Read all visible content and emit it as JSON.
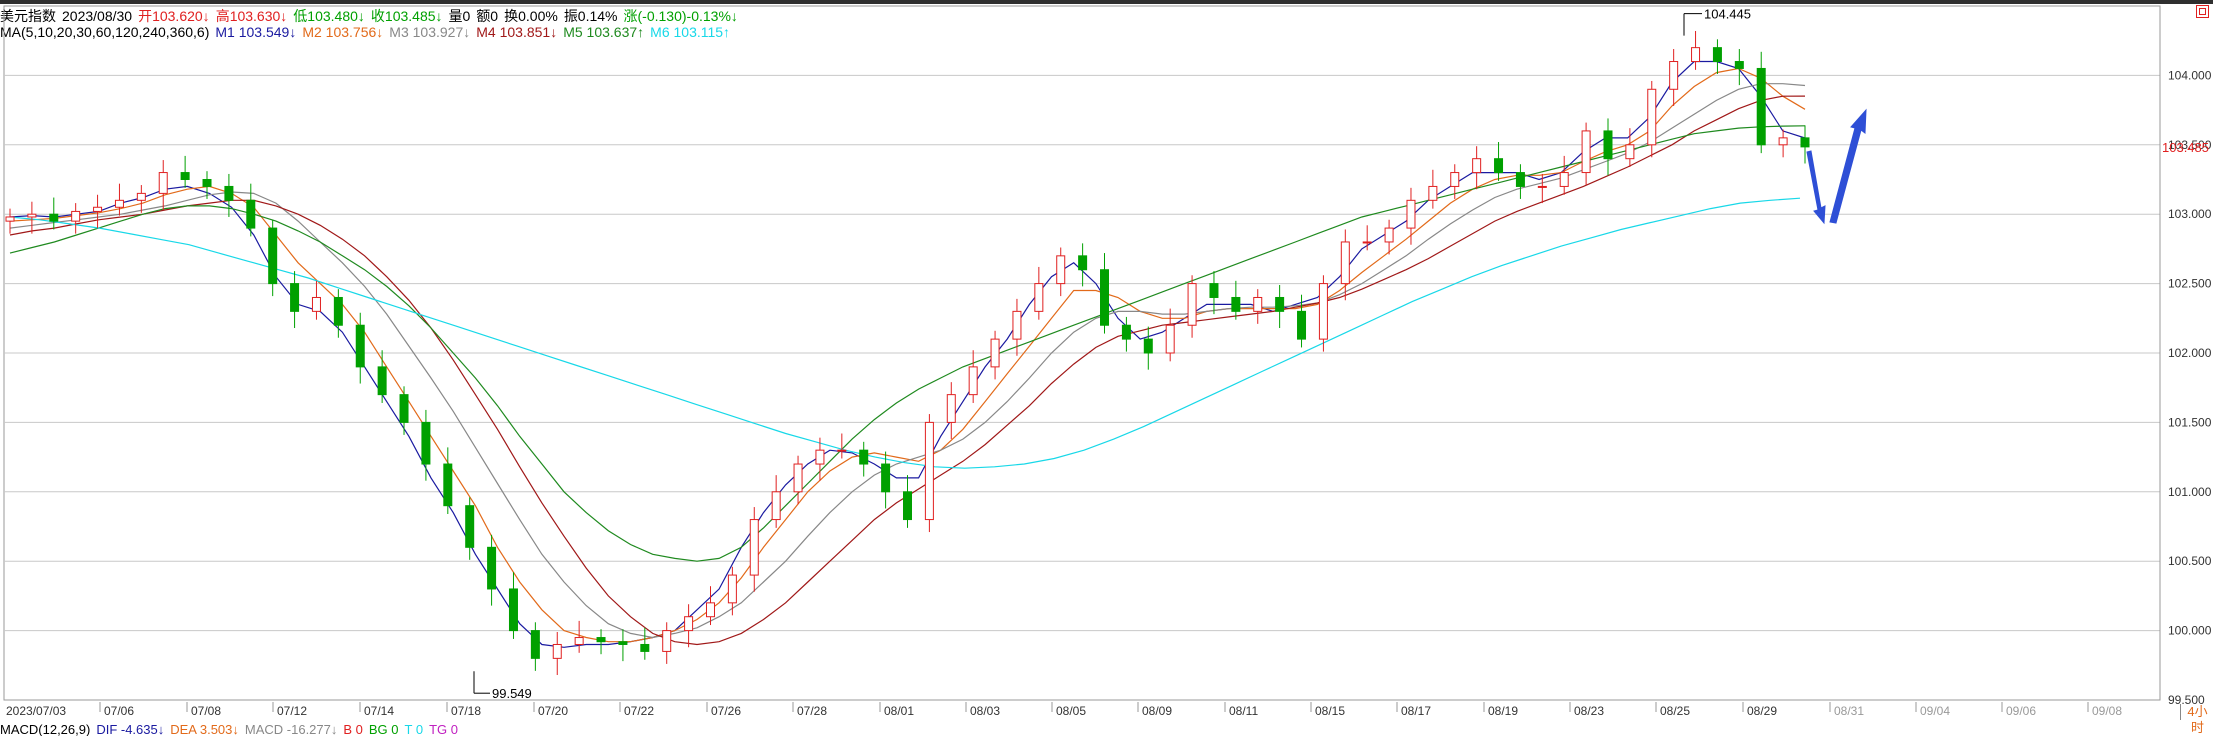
{
  "header": {
    "symbol": "美元指数",
    "date": "2023/08/30",
    "open_label": "开",
    "open": "103.620↓",
    "high_label": "高",
    "high": "103.630↓",
    "low_label": "低",
    "low": "103.480↓",
    "close_label": "收",
    "close": "103.485↓",
    "volume": "量0",
    "amount": "额0",
    "turnover": "换0.00%",
    "amplitude": "振0.14%",
    "change": "涨(-0.130)-0.13%↓"
  },
  "ma_header": {
    "label": "MA(5,10,20,30,60,120,240,360,6)",
    "m1": "M1 103.549↓",
    "m2": "M2 103.756↓",
    "m3": "M3 103.927↓",
    "m4": "M4 103.851↓",
    "m5": "M5 103.637↑",
    "m6": "M6 103.115↑"
  },
  "macd_header": {
    "label": "MACD(12,26,9)",
    "dif": "DIF -4.635↓",
    "dea": "DEA 3.503↓",
    "macd": "MACD -16.277↓",
    "b": "B 0",
    "bg": "BG 0",
    "t": "T 0",
    "tg": "TG 0"
  },
  "period_tab": "4小时",
  "colors": {
    "up": "#e02020",
    "down": "#00a000",
    "ma1": "#1a1aa0",
    "ma2": "#e26a1a",
    "ma3": "#888888",
    "ma4": "#a01818",
    "ma5": "#1f8a1f",
    "ma6": "#18d8e8",
    "arrow": "#2e4fd6",
    "grid": "#c8c8c8"
  },
  "chart_data": {
    "type": "candlestick",
    "ylim": [
      99.5,
      104.5
    ],
    "yticks": [
      "104.000",
      "103.500",
      "103.000",
      "102.500",
      "102.000",
      "101.500",
      "101.000",
      "100.500",
      "100.000",
      "99.500"
    ],
    "current_price": "103.485",
    "xlabels": [
      "2023/07/03",
      "07/06",
      "07/08",
      "07/12",
      "07/14",
      "07/18",
      "07/20",
      "07/22",
      "07/26",
      "07/28",
      "08/01",
      "08/03",
      "08/05",
      "08/09",
      "08/11",
      "08/15",
      "08/17",
      "08/19",
      "08/23",
      "08/25",
      "08/29",
      "08/31",
      "09/04",
      "09/06",
      "09/08"
    ],
    "annotations": [
      {
        "label": "104.445",
        "value": 104.445,
        "type": "high"
      },
      {
        "label": "99.549",
        "value": 99.549,
        "type": "low"
      }
    ],
    "close_series": [
      102.98,
      103.0,
      102.95,
      103.02,
      103.05,
      103.1,
      103.15,
      103.3,
      103.25,
      103.2,
      103.1,
      102.9,
      102.5,
      102.3,
      102.4,
      102.2,
      101.9,
      101.7,
      101.5,
      101.2,
      100.9,
      100.6,
      100.3,
      100.0,
      99.8,
      99.9,
      99.95,
      99.92,
      99.9,
      99.85,
      100.0,
      100.1,
      100.2,
      100.4,
      100.8,
      101.0,
      101.2,
      101.3,
      101.3,
      101.2,
      101.0,
      100.8,
      101.5,
      101.7,
      101.9,
      102.1,
      102.3,
      102.5,
      102.7,
      102.6,
      102.2,
      102.1,
      102.0,
      102.2,
      102.5,
      102.4,
      102.3,
      102.4,
      102.3,
      102.1,
      102.5,
      102.8,
      102.8,
      102.9,
      103.1,
      103.2,
      103.3,
      103.4,
      103.3,
      103.2,
      103.2,
      103.3,
      103.6,
      103.4,
      103.5,
      103.9,
      104.1,
      104.2,
      104.1,
      104.05,
      103.5,
      103.55,
      103.485
    ],
    "ma_series": [
      {
        "name": "M1",
        "values": [
          102.98,
          102.99,
          102.98,
          103.0,
          103.02,
          103.08,
          103.12,
          103.18,
          103.2,
          103.15,
          103.05,
          102.85,
          102.55,
          102.35,
          102.3,
          102.15,
          101.9,
          101.65,
          101.4,
          101.1,
          100.85,
          100.55,
          100.3,
          100.05,
          99.9,
          99.88,
          99.9,
          99.9,
          99.92,
          99.95,
          100.0,
          100.15,
          100.3,
          100.6,
          100.85,
          101.05,
          101.2,
          101.3,
          101.28,
          101.2,
          101.1,
          101.1,
          101.4,
          101.65,
          101.9,
          102.1,
          102.35,
          102.55,
          102.65,
          102.5,
          102.25,
          102.1,
          102.15,
          102.25,
          102.35,
          102.35,
          102.35,
          102.3,
          102.35,
          102.4,
          102.55,
          102.75,
          102.85,
          102.95,
          103.1,
          103.2,
          103.3,
          103.3,
          103.3,
          103.25,
          103.3,
          103.45,
          103.55,
          103.55,
          103.7,
          103.95,
          104.1,
          104.1,
          104.05,
          103.85,
          103.6,
          103.549
        ]
      },
      {
        "name": "M2",
        "values": [
          102.95,
          102.96,
          102.97,
          102.99,
          103.01,
          103.04,
          103.08,
          103.14,
          103.18,
          103.2,
          103.15,
          103.05,
          102.85,
          102.65,
          102.5,
          102.35,
          102.15,
          101.9,
          101.65,
          101.4,
          101.15,
          100.9,
          100.6,
          100.35,
          100.15,
          100.0,
          99.95,
          99.92,
          99.92,
          99.95,
          100.0,
          100.08,
          100.2,
          100.38,
          100.6,
          100.8,
          101.0,
          101.15,
          101.25,
          101.28,
          101.25,
          101.22,
          101.3,
          101.45,
          101.65,
          101.85,
          102.05,
          102.25,
          102.45,
          102.45,
          102.4,
          102.3,
          102.25,
          102.25,
          102.3,
          102.32,
          102.32,
          102.32,
          102.32,
          102.35,
          102.45,
          102.58,
          102.7,
          102.82,
          102.95,
          103.08,
          103.18,
          103.25,
          103.28,
          103.28,
          103.3,
          103.38,
          103.45,
          103.5,
          103.6,
          103.78,
          103.92,
          104.02,
          104.05,
          103.98,
          103.85,
          103.756
        ]
      },
      {
        "name": "M3",
        "values": [
          102.9,
          102.92,
          102.94,
          102.96,
          102.98,
          103.0,
          103.03,
          103.06,
          103.1,
          103.14,
          103.16,
          103.15,
          103.08,
          102.95,
          102.8,
          102.65,
          102.48,
          102.28,
          102.05,
          101.82,
          101.58,
          101.32,
          101.06,
          100.8,
          100.55,
          100.35,
          100.18,
          100.05,
          99.98,
          99.95,
          99.98,
          100.02,
          100.1,
          100.2,
          100.35,
          100.5,
          100.68,
          100.85,
          101.0,
          101.12,
          101.2,
          101.25,
          101.3,
          101.38,
          101.5,
          101.65,
          101.82,
          102.0,
          102.15,
          102.25,
          102.3,
          102.3,
          102.28,
          102.28,
          102.3,
          102.32,
          102.33,
          102.33,
          102.34,
          102.36,
          102.42,
          102.5,
          102.6,
          102.7,
          102.82,
          102.93,
          103.03,
          103.12,
          103.18,
          103.22,
          103.26,
          103.32,
          103.38,
          103.44,
          103.52,
          103.62,
          103.72,
          103.82,
          103.9,
          103.94,
          103.94,
          103.927
        ]
      },
      {
        "name": "M4",
        "values": [
          102.85,
          102.88,
          102.9,
          102.93,
          102.96,
          102.98,
          103.0,
          103.03,
          103.06,
          103.08,
          103.1,
          103.1,
          103.06,
          103.0,
          102.92,
          102.82,
          102.7,
          102.55,
          102.38,
          102.18,
          101.95,
          101.7,
          101.45,
          101.18,
          100.92,
          100.68,
          100.45,
          100.25,
          100.1,
          99.98,
          99.92,
          99.9,
          99.92,
          99.98,
          100.08,
          100.2,
          100.35,
          100.5,
          100.65,
          100.8,
          100.92,
          101.02,
          101.12,
          101.22,
          101.34,
          101.48,
          101.62,
          101.78,
          101.92,
          102.04,
          102.12,
          102.16,
          102.2,
          102.22,
          102.24,
          102.26,
          102.28,
          102.3,
          102.33,
          102.36,
          102.4,
          102.46,
          102.53,
          102.6,
          102.68,
          102.77,
          102.86,
          102.95,
          103.02,
          103.08,
          103.14,
          103.2,
          103.27,
          103.34,
          103.42,
          103.5,
          103.6,
          103.68,
          103.76,
          103.82,
          103.85,
          103.851
        ]
      },
      {
        "name": "M5",
        "values": [
          102.72,
          102.76,
          102.8,
          102.85,
          102.9,
          102.95,
          103.0,
          103.04,
          103.06,
          103.06,
          103.04,
          103.0,
          102.95,
          102.88,
          102.8,
          102.7,
          102.6,
          102.48,
          102.34,
          102.18,
          102.0,
          101.82,
          101.62,
          101.4,
          101.2,
          101.0,
          100.85,
          100.72,
          100.62,
          100.55,
          100.52,
          100.5,
          100.52,
          100.6,
          100.74,
          100.9,
          101.06,
          101.22,
          101.38,
          101.52,
          101.64,
          101.74,
          101.82,
          101.9,
          101.96,
          102.02,
          102.08,
          102.14,
          102.2,
          102.26,
          102.32,
          102.38,
          102.44,
          102.5,
          102.56,
          102.62,
          102.68,
          102.74,
          102.8,
          102.86,
          102.92,
          102.98,
          103.02,
          103.06,
          103.1,
          103.14,
          103.18,
          103.22,
          103.26,
          103.3,
          103.34,
          103.38,
          103.42,
          103.46,
          103.5,
          103.54,
          103.58,
          103.6,
          103.62,
          103.63,
          103.635,
          103.637
        ]
      },
      {
        "name": "M6",
        "values": [
          102.98,
          102.96,
          102.93,
          102.9,
          102.86,
          102.82,
          102.78,
          102.72,
          102.66,
          102.6,
          102.54,
          102.47,
          102.4,
          102.33,
          102.26,
          102.19,
          102.12,
          102.05,
          101.98,
          101.91,
          101.84,
          101.77,
          101.7,
          101.63,
          101.56,
          101.49,
          101.42,
          101.36,
          101.3,
          101.25,
          101.21,
          101.18,
          101.17,
          101.18,
          101.2,
          101.24,
          101.3,
          101.38,
          101.47,
          101.57,
          101.67,
          101.77,
          101.87,
          101.97,
          102.07,
          102.17,
          102.27,
          102.37,
          102.46,
          102.55,
          102.63,
          102.7,
          102.77,
          102.83,
          102.89,
          102.94,
          102.99,
          103.04,
          103.08,
          103.1,
          103.115
        ]
      }
    ]
  }
}
